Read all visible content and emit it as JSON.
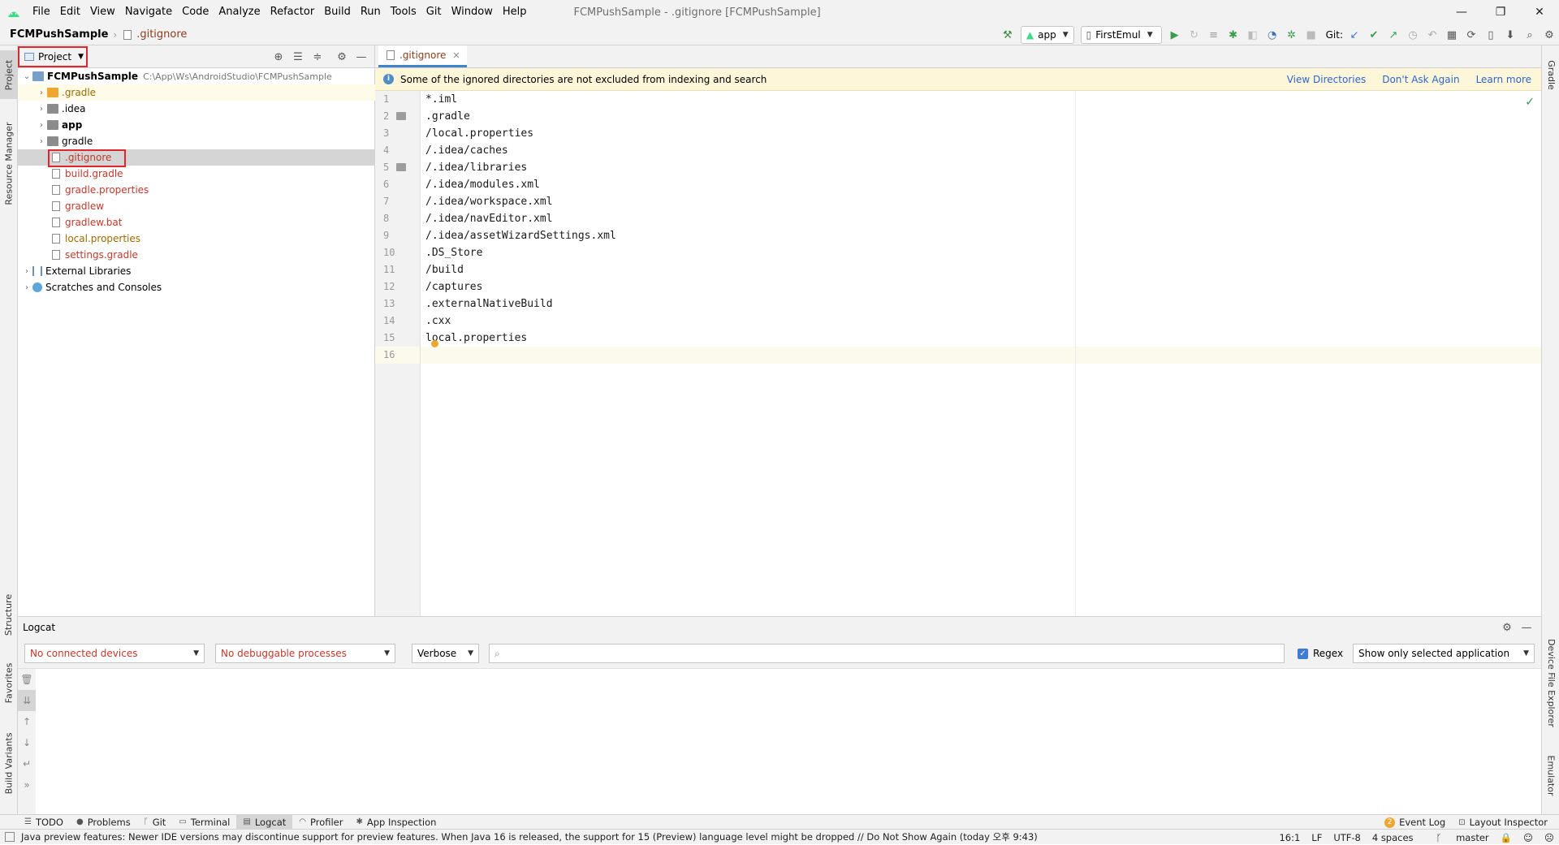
{
  "menubar": {
    "items": [
      "File",
      "Edit",
      "View",
      "Navigate",
      "Code",
      "Analyze",
      "Refactor",
      "Build",
      "Run",
      "Tools",
      "Git",
      "Window",
      "Help"
    ],
    "title": "FCMPushSample - .gitignore [FCMPushSample]",
    "window_controls": [
      "—",
      "❐",
      "✕"
    ]
  },
  "navbar": {
    "project": "FCMPushSample",
    "file": ".gitignore",
    "run_config": "app",
    "device": "FirstEmul",
    "git_label": "Git:"
  },
  "left_tabs": [
    "Project",
    "Resource Manager",
    "Structure",
    "Favorites",
    "Build Variants"
  ],
  "right_tabs": [
    "Gradle",
    "Device File Explorer",
    "Emulator"
  ],
  "project_panel": {
    "view_mode": "Project",
    "root": {
      "name": "FCMPushSample",
      "path": "C:\\App\\Ws\\AndroidStudio\\FCMPushSample"
    },
    "items": [
      {
        "label": ".gradle"
      },
      {
        "label": ".idea"
      },
      {
        "label": "app"
      },
      {
        "label": "gradle"
      },
      {
        "label": ".gitignore"
      },
      {
        "label": "build.gradle"
      },
      {
        "label": "gradle.properties"
      },
      {
        "label": "gradlew"
      },
      {
        "label": "gradlew.bat"
      },
      {
        "label": "local.properties"
      },
      {
        "label": "settings.gradle"
      }
    ],
    "external_libraries": "External Libraries",
    "scratches": "Scratches and Consoles"
  },
  "editor": {
    "tab": ".gitignore",
    "banner": {
      "message": "Some of the ignored directories are not excluded from indexing and search",
      "links": [
        "View Directories",
        "Don't Ask Again",
        "Learn more"
      ]
    },
    "line_numbers": [
      "1",
      "2",
      "3",
      "4",
      "5",
      "6",
      "7",
      "8",
      "9",
      "10",
      "11",
      "12",
      "13",
      "14",
      "15",
      "16"
    ],
    "lines": [
      "*.iml",
      ".gradle",
      "/local.properties",
      "/.idea/caches",
      "/.idea/libraries",
      "/.idea/modules.xml",
      "/.idea/workspace.xml",
      "/.idea/navEditor.xml",
      "/.idea/assetWizardSettings.xml",
      ".DS_Store",
      "/build",
      "/captures",
      ".externalNativeBuild",
      ".cxx",
      "local.properties",
      ""
    ]
  },
  "logcat": {
    "title": "Logcat",
    "device": "No connected devices",
    "process": "No debuggable processes",
    "level": "Verbose",
    "search_placeholder": "",
    "regex_label": "Regex",
    "filter": "Show only selected application"
  },
  "bottom_tools": [
    "TODO",
    "Problems",
    "Git",
    "Terminal",
    "Logcat",
    "Profiler",
    "App Inspection"
  ],
  "bottom_right_tools": {
    "event_log_count": "2",
    "event_log": "Event Log",
    "layout_inspector": "Layout Inspector"
  },
  "statusbar": {
    "message": "Java preview features: Newer IDE versions may discontinue support for preview features. When Java 16 is released, the support for 15 (Preview) language level might be dropped // Do Not Show Again (today 오후 9:43)",
    "position": "16:1",
    "line_sep": "LF",
    "encoding": "UTF-8",
    "indent": "4 spaces",
    "branch": "master"
  }
}
